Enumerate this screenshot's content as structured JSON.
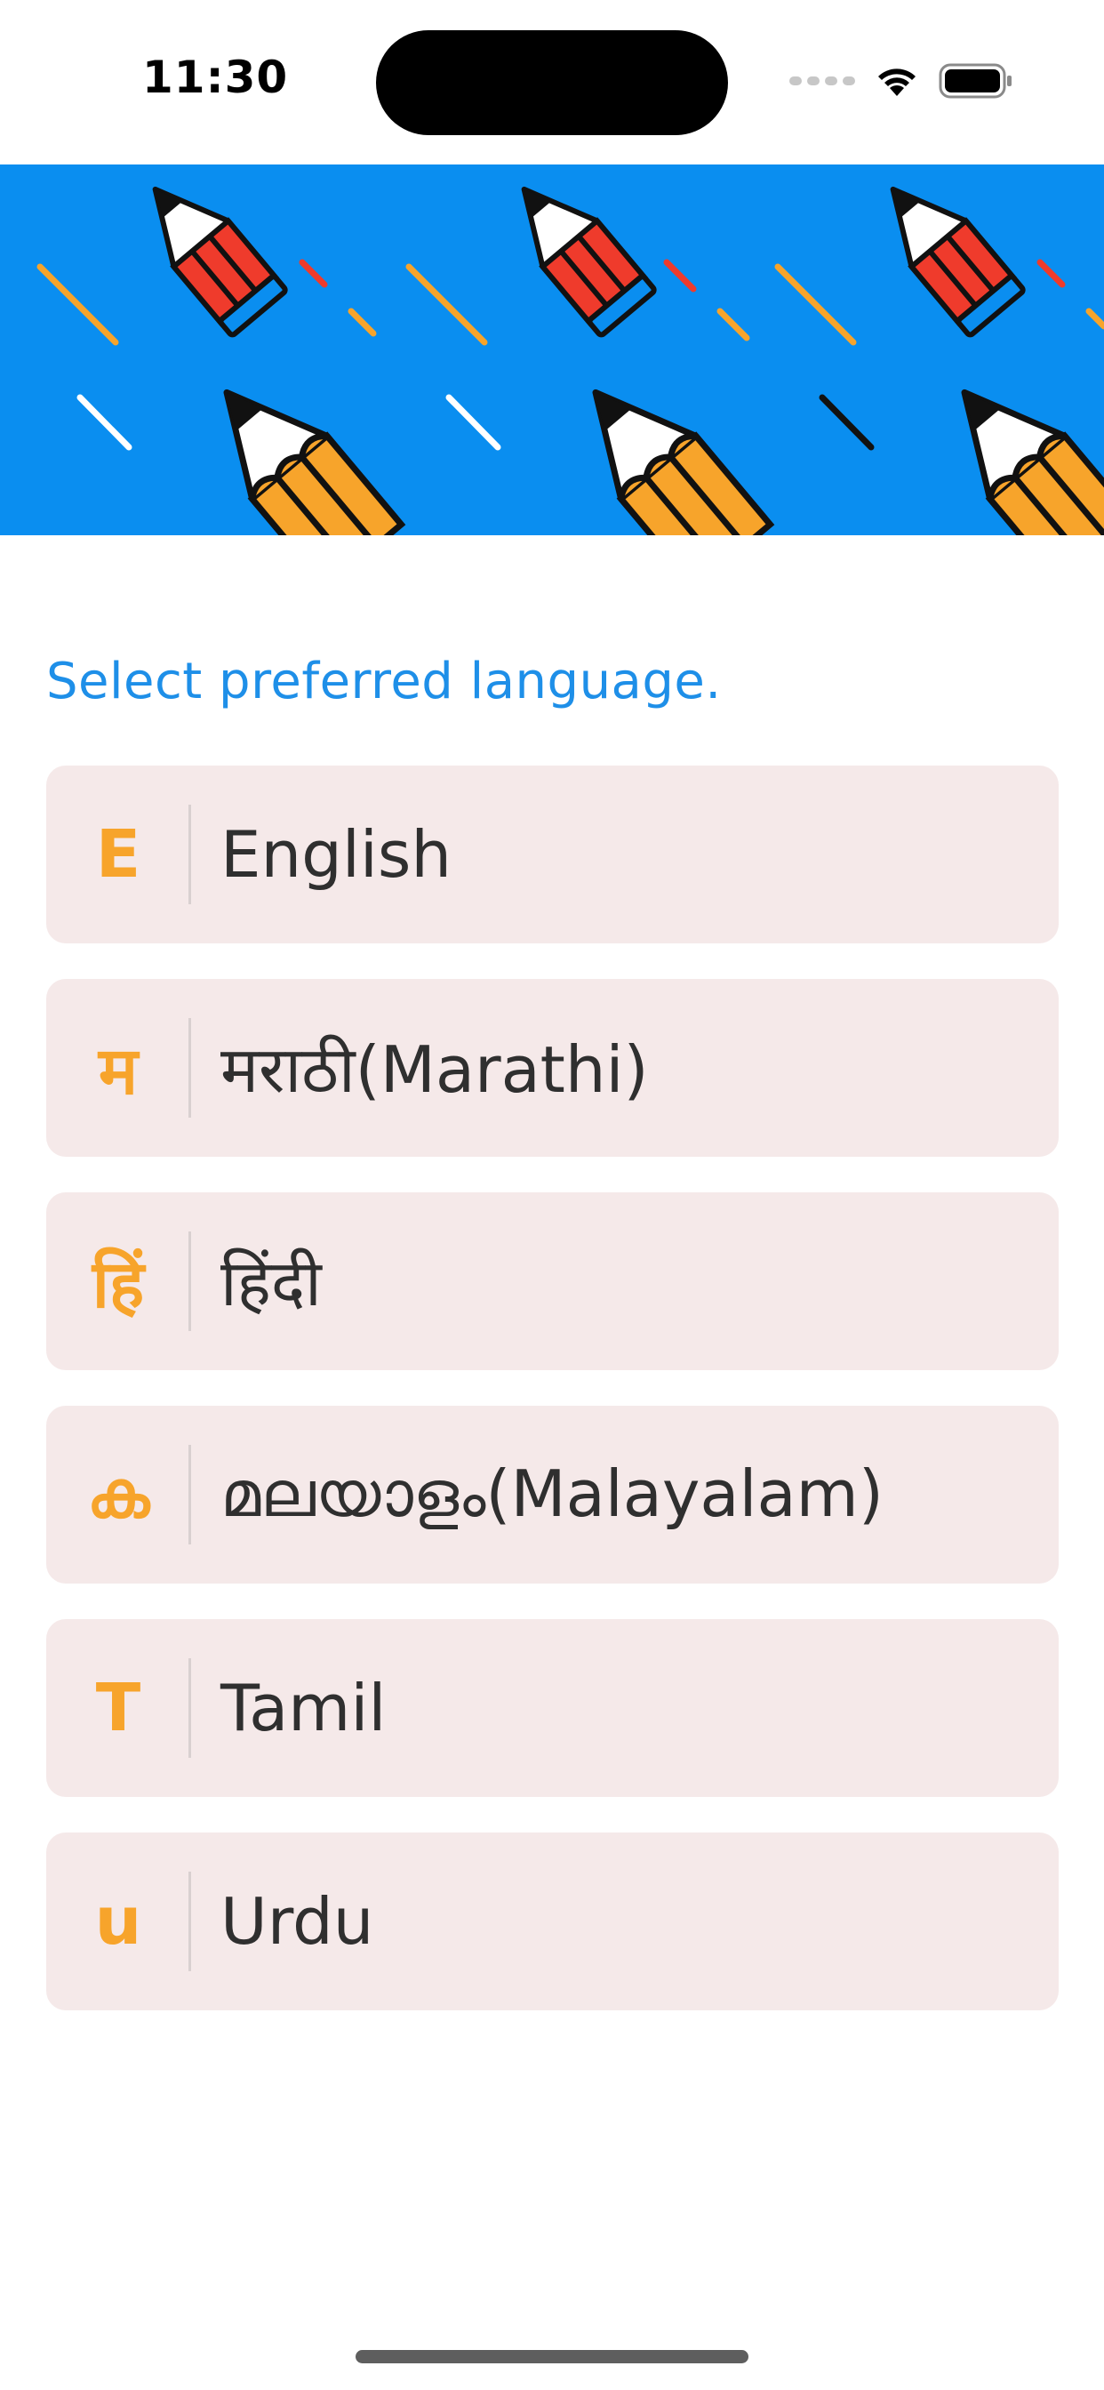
{
  "status_bar": {
    "time": "11:30"
  },
  "banner": {
    "background_color": "#0a8ef0",
    "pencil_colors": [
      "#f7a42b",
      "#ef3b2c",
      "#ffffff"
    ]
  },
  "prompt": "Select preferred language.",
  "colors": {
    "accent_blue": "#1e8fe8",
    "glyph_orange": "#f7a42b",
    "item_background": "#f5e9e9",
    "text_dark": "#2f2f2f"
  },
  "languages": [
    {
      "glyph": "E",
      "label": "English"
    },
    {
      "glyph": "म",
      "label": "मराठी(Marathi)"
    },
    {
      "glyph": "हिं",
      "label": "हिंदी"
    },
    {
      "glyph": "ക",
      "label": "മലയാളം(Malayalam)"
    },
    {
      "glyph": "T",
      "label": "Tamil"
    },
    {
      "glyph": "u",
      "label": "Urdu"
    }
  ]
}
